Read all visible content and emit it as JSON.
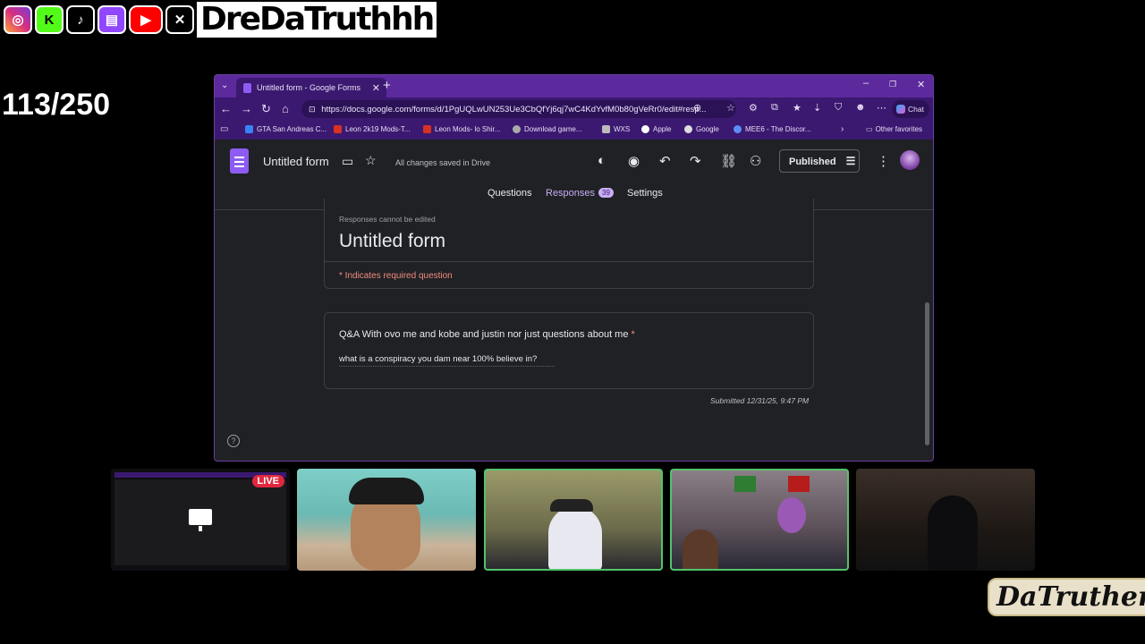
{
  "overlay": {
    "handle": "DreDaTruthhh",
    "counter": "113/250",
    "social_icons": [
      "instagram-icon",
      "kick-icon",
      "tiktok-icon",
      "twitch-icon",
      "youtube-icon",
      "x-icon"
    ],
    "watermark": "DaTruthers"
  },
  "browser": {
    "tab_title": "Untitled form - Google Forms",
    "url": "https://docs.google.com/forms/d/1PgUQLwUN253Ue3CbQfYj6qj7wC4KdYvfM0b80gVeRr0/edit#resp...",
    "chat_label": "Chat",
    "bookmarks": [
      "GTA San Andreas C...",
      "Leon 2k19 Mods-T...",
      "Leon Mods- lo Shir...",
      "Download game...",
      "WXS",
      "Apple",
      "Google",
      "MEE6 - The Discor..."
    ],
    "other_favorites": "Other favorites"
  },
  "form_header": {
    "title": "Untitled form",
    "save_status": "All changes saved in Drive",
    "publish_label": "Published",
    "tabs": {
      "questions": "Questions",
      "responses": "Responses",
      "responses_count": "39",
      "settings": "Settings"
    }
  },
  "response": {
    "notice": "Responses cannot be edited",
    "form_title": "Untitled form",
    "required_note": "* Indicates required question",
    "question": "Q&A With ovo me and kobe and justin nor just questions about me",
    "required_star": "*",
    "answer": "what is a conspiracy you dam near 100% believe in?",
    "submitted": "Submitted 12/31/25, 9:47 PM"
  },
  "thumbnails": {
    "live_label": "LIVE"
  },
  "colors": {
    "browser_accent": "#5c2a9d",
    "forms_purple": "#8e5cf3",
    "required_red": "#f28b82",
    "live_red": "#e0283f",
    "active_border": "#52c36b"
  }
}
